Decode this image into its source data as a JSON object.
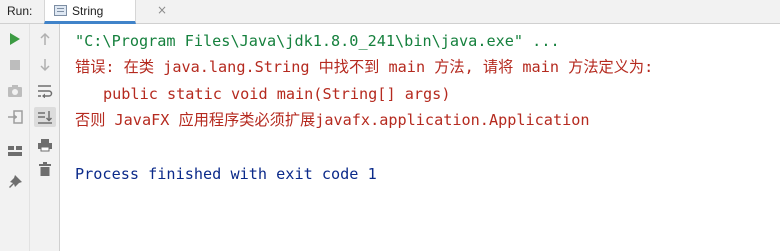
{
  "run_label": "Run:",
  "tab": {
    "label": "String",
    "icon": "file-icon",
    "close": "×"
  },
  "console": {
    "command_line": "\"C:\\Program Files\\Java\\jdk1.8.0_241\\bin\\java.exe\" ...",
    "error_line1": "错误: 在类 java.lang.String 中找不到 main 方法, 请将 main 方法定义为:",
    "error_line2": "public static void main(String[] args)",
    "error_line3": "否则 JavaFX 应用程序类必须扩展javafx.application.Application",
    "finished_line": "Process finished with exit code 1"
  },
  "colors": {
    "command": "#15803d",
    "error": "#b52a1f",
    "finished": "#0b2a8a",
    "accent": "#4083c9"
  },
  "toolbar_left": [
    "rerun-icon",
    "stop-icon",
    "camera-icon",
    "exit-icon",
    "layout-icon",
    "pin-icon"
  ],
  "toolbar_right": [
    "up-arrow-icon",
    "down-arrow-icon",
    "soft-wrap-icon",
    "scroll-to-end-icon",
    "print-icon",
    "trash-icon"
  ]
}
